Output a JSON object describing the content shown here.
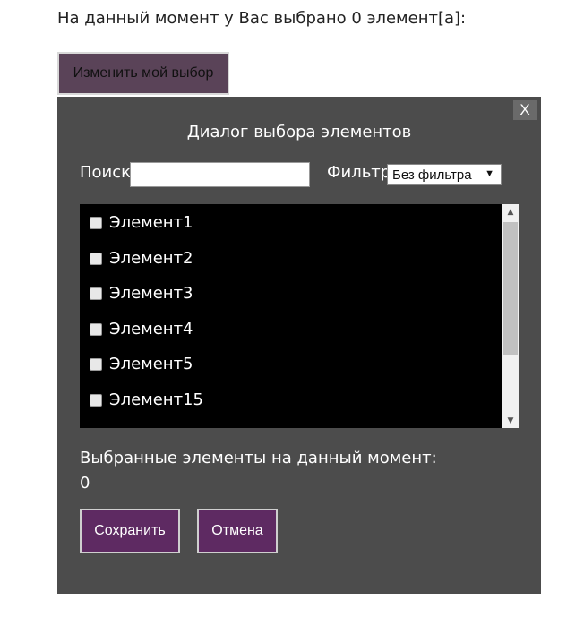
{
  "summary_text": "На данный момент у Вас выбрано 0 элемент[а]:",
  "change_selection_button": "Изменить мой выбор",
  "dialog": {
    "close_label": "X",
    "title": "Диалог выбора элементов",
    "search": {
      "label": "Поиск",
      "value": "",
      "placeholder": ""
    },
    "filter": {
      "label": "Фильтр",
      "selected": "Без фильтра"
    },
    "items": [
      {
        "label": "Элемент1",
        "checked": false
      },
      {
        "label": "Элемент2",
        "checked": false
      },
      {
        "label": "Элемент3",
        "checked": false
      },
      {
        "label": "Элемент4",
        "checked": false
      },
      {
        "label": "Элемент5",
        "checked": false
      },
      {
        "label": "Элемент15",
        "checked": false
      }
    ],
    "selected_label": "Выбранные элементы на данный момент:",
    "selected_count": "0",
    "save_label": "Сохранить",
    "cancel_label": "Отмена"
  },
  "colors": {
    "dialog_bg": "#4c4c4c",
    "button_purple": "#5e2a62",
    "change_button_bg": "#5a4358",
    "list_bg": "#000000"
  }
}
